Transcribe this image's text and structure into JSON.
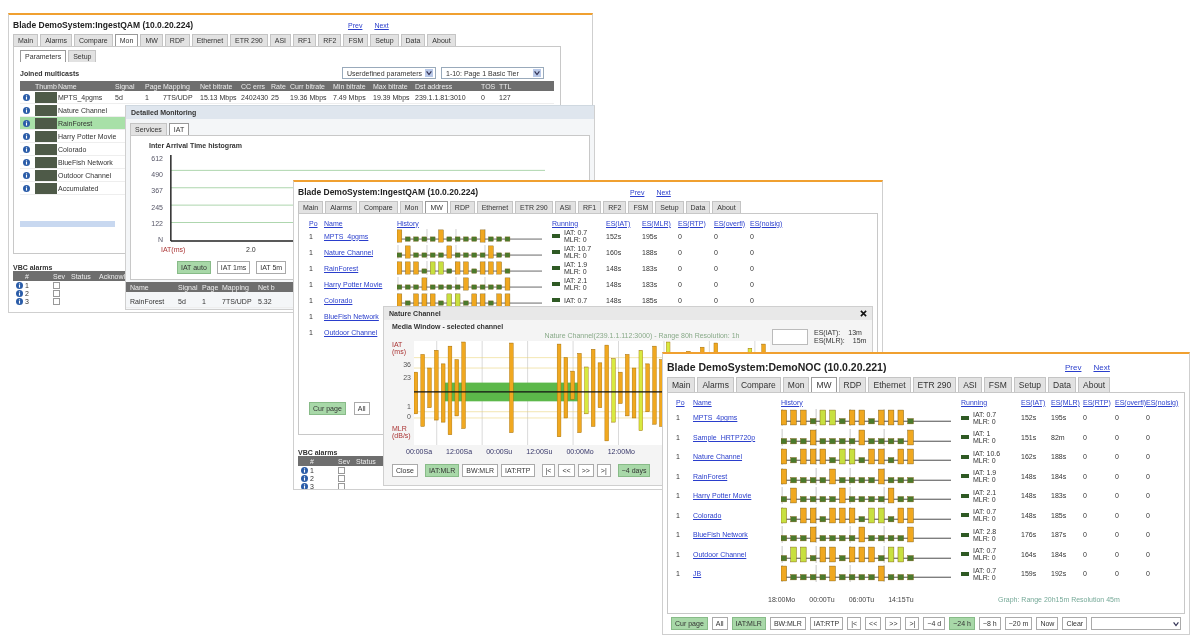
{
  "mon_window": {
    "title": "Blade DemoSystem:IngestQAM (10.0.20.224)",
    "nav": [
      "Prev",
      "Next"
    ],
    "tabs": [
      {
        "label": "Main",
        "selected": false
      },
      {
        "label": "Alarms",
        "selected": false
      },
      {
        "label": "Compare",
        "selected": false
      },
      {
        "label": "Mon",
        "selected": true
      },
      {
        "label": "MW",
        "selected": false
      },
      {
        "label": "RDP",
        "selected": false
      },
      {
        "label": "Ethernet",
        "selected": false
      },
      {
        "label": "ETR 290",
        "selected": false
      },
      {
        "label": "ASI",
        "selected": false
      },
      {
        "label": "RF1",
        "selected": false
      },
      {
        "label": "RF2",
        "selected": false
      },
      {
        "label": "FSM",
        "selected": false
      },
      {
        "label": "Setup",
        "selected": false
      },
      {
        "label": "Data",
        "selected": false
      },
      {
        "label": "About",
        "selected": false
      }
    ],
    "subtabs": [
      {
        "label": "Parameters",
        "selected": true
      },
      {
        "label": "Setup",
        "selected": false
      }
    ],
    "section_title": "Joined multicasts",
    "dropdowns": [
      "Userdefined parameters",
      "1-10: Page 1 Basic Tier"
    ],
    "columns": [
      "Thumb",
      "Name",
      "Signal",
      "Page",
      "Mapping",
      "Net bitrate",
      "CC errs",
      "Rate",
      "Curr bitrate",
      "Min bitrate",
      "Max bitrate",
      "Dst address",
      "TOS",
      "TTL"
    ],
    "rows": [
      {
        "name": "MPTS_4pgms",
        "selected": false,
        "cells": [
          "5d",
          "1",
          "7TS/UDP",
          "15.13 Mbps",
          "2402430",
          "25",
          "19.36 Mbps",
          "7.49 Mbps",
          "19.39 Mbps",
          "239.1.1.81:3010",
          "0",
          "127"
        ]
      },
      {
        "name": "Nature Channel",
        "selected": false
      },
      {
        "name": "RainForest",
        "selected": true
      },
      {
        "name": "Harry Potter Movie",
        "selected": false
      },
      {
        "name": "Colorado",
        "selected": false
      },
      {
        "name": "BlueFish Network",
        "selected": false
      },
      {
        "name": "Outdoor Channel",
        "selected": false
      },
      {
        "name": "Accumulated",
        "selected": false
      }
    ],
    "alarms": {
      "title": "VBC alarms",
      "columns": [
        "#",
        "Sev",
        "Status",
        "Acknowl"
      ],
      "rows": [
        {
          "number": "1",
          "checked": false
        },
        {
          "number": "2",
          "checked": false
        },
        {
          "number": "3",
          "checked": false
        }
      ]
    }
  },
  "detail_window": {
    "title": "Detailed Monitoring",
    "tabs": [
      {
        "label": "Services",
        "selected": false
      },
      {
        "label": "IAT",
        "selected": true
      }
    ],
    "chart_title": "Inter Arrival Time histogram",
    "yticks": [
      "612",
      "490",
      "367",
      "245",
      "122",
      "N"
    ],
    "xlabels": [
      "IAT(ms)",
      "2.0"
    ],
    "buttons": [
      {
        "label": "IAT auto",
        "selected": true
      },
      {
        "label": "IAT 1ms",
        "selected": false
      },
      {
        "label": "IAT 5m",
        "selected": false
      }
    ],
    "columns": [
      "Name",
      "Signal",
      "Page",
      "Mapping",
      "Net b"
    ],
    "row": [
      "RainForest",
      "5d",
      "1",
      "7TS/UDP",
      "5.32"
    ]
  },
  "mw_window": {
    "title": "Blade DemoSystem:IngestQAM (10.0.20.224)",
    "nav": [
      "Prev",
      "Next"
    ],
    "tabs": [
      {
        "label": "Main",
        "selected": false
      },
      {
        "label": "Alarms",
        "selected": false
      },
      {
        "label": "Compare",
        "selected": false
      },
      {
        "label": "Mon",
        "selected": false
      },
      {
        "label": "MW",
        "selected": true
      },
      {
        "label": "RDP",
        "selected": false
      },
      {
        "label": "Ethernet",
        "selected": false
      },
      {
        "label": "ETR 290",
        "selected": false
      },
      {
        "label": "ASI",
        "selected": false
      },
      {
        "label": "RF1",
        "selected": false
      },
      {
        "label": "RF2",
        "selected": false
      },
      {
        "label": "FSM",
        "selected": false
      },
      {
        "label": "Setup",
        "selected": false
      },
      {
        "label": "Data",
        "selected": false
      },
      {
        "label": "About",
        "selected": false
      }
    ],
    "columns": [
      "Po",
      "Name",
      "History",
      "Running",
      "ES(IAT)",
      "ES(MLR)",
      "ES(RTP)",
      "ES(overfl)",
      "ES(noisig)"
    ],
    "rows": [
      {
        "po": "1",
        "name": "MPTS_4pgms",
        "iat": "IAT: 0.7",
        "mlr": "MLR: 0",
        "es": [
          "152s",
          "195s",
          "0",
          "0",
          "0"
        ]
      },
      {
        "po": "1",
        "name": "Nature Channel",
        "iat": "IAT: 10.7",
        "mlr": "MLR: 0",
        "es": [
          "160s",
          "188s",
          "0",
          "0",
          "0"
        ]
      },
      {
        "po": "1",
        "name": "RainForest",
        "iat": "IAT: 1.9",
        "mlr": "MLR: 0",
        "es": [
          "148s",
          "183s",
          "0",
          "0",
          "0"
        ]
      },
      {
        "po": "1",
        "name": "Harry Potter Movie",
        "iat": "IAT: 2.1",
        "mlr": "MLR: 0",
        "es": [
          "148s",
          "183s",
          "0",
          "0",
          "0"
        ]
      },
      {
        "po": "1",
        "name": "Colorado",
        "iat": "IAT: 0.7",
        "es": [
          "148s",
          "185s",
          "0",
          "0",
          "0"
        ]
      },
      {
        "po": "1",
        "name": "BlueFish Network"
      },
      {
        "po": "1",
        "name": "Outdoor Channel"
      }
    ],
    "buttons": [
      {
        "label": "Cur page",
        "selected": true
      },
      {
        "label": "All",
        "selected": false
      }
    ],
    "alarms": {
      "title": "VBC alarms",
      "columns": [
        "#",
        "Sev",
        "Status"
      ],
      "rows": [
        {
          "number": "1",
          "checked": false
        },
        {
          "number": "2",
          "checked": false
        },
        {
          "number": "3",
          "checked": false
        }
      ]
    }
  },
  "channel_popup": {
    "title": "Nature Channel",
    "subtitle": "Media Window - selected channel",
    "caption": "Nature Channel(239.1.1.112:3000) - Range 80h Resolution: 1h",
    "top_axis": "IAT (ms)",
    "bottom_axis": "MLR (dB/s)",
    "yticks": [
      "36",
      "23",
      "1",
      "0"
    ],
    "xlabels": [
      "00:00Sa",
      "12:00Sa",
      "00:00Su",
      "12:00Su",
      "00:00Mo",
      "12:00Mo"
    ],
    "stats": [
      {
        "label": "ES(IAT):",
        "value": "13m"
      },
      {
        "label": "ES(MLR):",
        "value": "15m"
      }
    ],
    "buttons": [
      {
        "label": "Close",
        "selected": false
      },
      {
        "label": "IAT:MLR",
        "selected": true
      },
      {
        "label": "BW:MLR",
        "selected": false
      },
      {
        "label": "IAT:RTP",
        "selected": false
      },
      {
        "label": "|<",
        "selected": false
      },
      {
        "label": "<<",
        "selected": false
      },
      {
        "label": ">>",
        "selected": false
      },
      {
        "label": ">|",
        "selected": false
      },
      {
        "label": "~4 days",
        "selected": true
      }
    ]
  },
  "noc_window": {
    "title": "Blade DemoSystem:DemoNOC (10.0.20.221)",
    "nav": [
      "Prev",
      "Next"
    ],
    "tabs": [
      {
        "label": "Main",
        "selected": false
      },
      {
        "label": "Alarms",
        "selected": false
      },
      {
        "label": "Compare",
        "selected": false
      },
      {
        "label": "Mon",
        "selected": false
      },
      {
        "label": "MW",
        "selected": true
      },
      {
        "label": "RDP",
        "selected": false
      },
      {
        "label": "Ethernet",
        "selected": false
      },
      {
        "label": "ETR 290",
        "selected": false
      },
      {
        "label": "ASI",
        "selected": false
      },
      {
        "label": "FSM",
        "selected": false
      },
      {
        "label": "Setup",
        "selected": false
      },
      {
        "label": "Data",
        "selected": false
      },
      {
        "label": "About",
        "selected": false
      }
    ],
    "columns": [
      "Po",
      "Name",
      "History",
      "Running",
      "ES(IAT)",
      "ES(MLR)",
      "ES(RTP)",
      "ES(overfl)",
      "ES(noisig)"
    ],
    "rows": [
      {
        "po": "1",
        "name": "MPTS_4pgms",
        "iat": "IAT: 0.7",
        "mlr": "MLR: 0",
        "es": [
          "152s",
          "195s",
          "0",
          "0",
          "0"
        ]
      },
      {
        "po": "1",
        "name": "Sample_HRTP720p",
        "iat": "IAT: 1",
        "mlr": "MLR: 0",
        "es": [
          "151s",
          "82m",
          "0",
          "0",
          "0"
        ]
      },
      {
        "po": "1",
        "name": "Nature Channel",
        "iat": "IAT: 10.6",
        "mlr": "MLR: 0",
        "es": [
          "162s",
          "188s",
          "0",
          "0",
          "0"
        ]
      },
      {
        "po": "1",
        "name": "RainForest",
        "iat": "IAT: 1.9",
        "mlr": "MLR: 0",
        "es": [
          "148s",
          "184s",
          "0",
          "0",
          "0"
        ]
      },
      {
        "po": "1",
        "name": "Harry Potter Movie",
        "iat": "IAT: 2.1",
        "mlr": "MLR: 0",
        "es": [
          "148s",
          "183s",
          "0",
          "0",
          "0"
        ]
      },
      {
        "po": "1",
        "name": "Colorado",
        "iat": "IAT: 0.7",
        "mlr": "MLR: 0",
        "es": [
          "148s",
          "185s",
          "0",
          "0",
          "0"
        ]
      },
      {
        "po": "1",
        "name": "BlueFish Network",
        "iat": "IAT: 2.8",
        "mlr": "MLR: 0",
        "es": [
          "176s",
          "187s",
          "0",
          "0",
          "0"
        ]
      },
      {
        "po": "1",
        "name": "Outdoor Channel",
        "iat": "IAT: 0.7",
        "mlr": "MLR: 0",
        "es": [
          "164s",
          "184s",
          "0",
          "0",
          "0"
        ]
      },
      {
        "po": "1",
        "name": "JB",
        "iat": "IAT: 0.7",
        "mlr": "MLR: 0",
        "es": [
          "159s",
          "192s",
          "0",
          "0",
          "0"
        ]
      }
    ],
    "xlabels": [
      "18:00Mo",
      "00:00Tu",
      "06:00Tu",
      "14:15Tu"
    ],
    "graph_note": "Graph: Range 20h15m Resolution 45m",
    "buttons": [
      {
        "label": "Cur page",
        "selected": true
      },
      {
        "label": "All",
        "selected": false
      },
      {
        "label": "IAT:MLR",
        "selected": true
      },
      {
        "label": "BW:MLR",
        "selected": false
      },
      {
        "label": "IAT:RTP",
        "selected": false
      },
      {
        "label": "|<",
        "selected": false
      },
      {
        "label": "<<",
        "selected": false
      },
      {
        "label": ">>",
        "selected": false
      },
      {
        "label": ">|",
        "selected": false
      },
      {
        "label": "~4 d",
        "selected": false
      },
      {
        "label": "~24 h",
        "selected": true
      },
      {
        "label": "~8 h",
        "selected": false
      },
      {
        "label": "~20 m",
        "selected": false
      },
      {
        "label": "Now",
        "selected": false
      },
      {
        "label": "Clear",
        "selected": false
      }
    ]
  }
}
